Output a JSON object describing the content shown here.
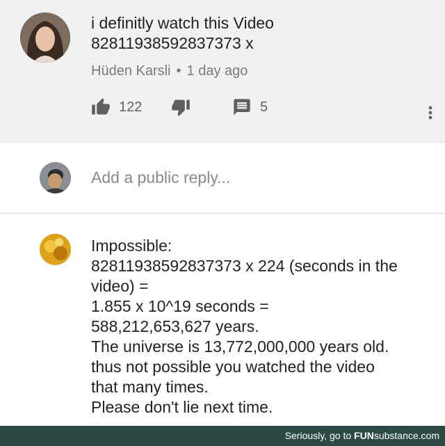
{
  "top_comment": {
    "text_line1": "i definitly watch this Video",
    "text_line2": "82811938592837373 x",
    "author": "Hüden Karsli",
    "separator": "•",
    "time": "1 day ago",
    "like_count": "122",
    "reply_count": "5"
  },
  "reply_box": {
    "placeholder": "Add a public reply..."
  },
  "reply": {
    "lines": [
      "Impossible:",
      "82811938592837373 x 224 (seconds in the",
      "video) =",
      "1.855 x 10^19 seconds =",
      "588,212,653,627 years.",
      "The universe is 13,772,000,000 years old.",
      "thus not possible you watched the video",
      "that many times.",
      "Please don't lie next time."
    ]
  },
  "footer": {
    "prefix": "Seriously, go to",
    "brand_bold": "FUN",
    "brand_rest": "substance.com"
  },
  "icons": {
    "like": "thumbs-up-icon",
    "dislike": "thumbs-down-icon",
    "replies": "comment-icon",
    "more": "more-vert-icon"
  }
}
